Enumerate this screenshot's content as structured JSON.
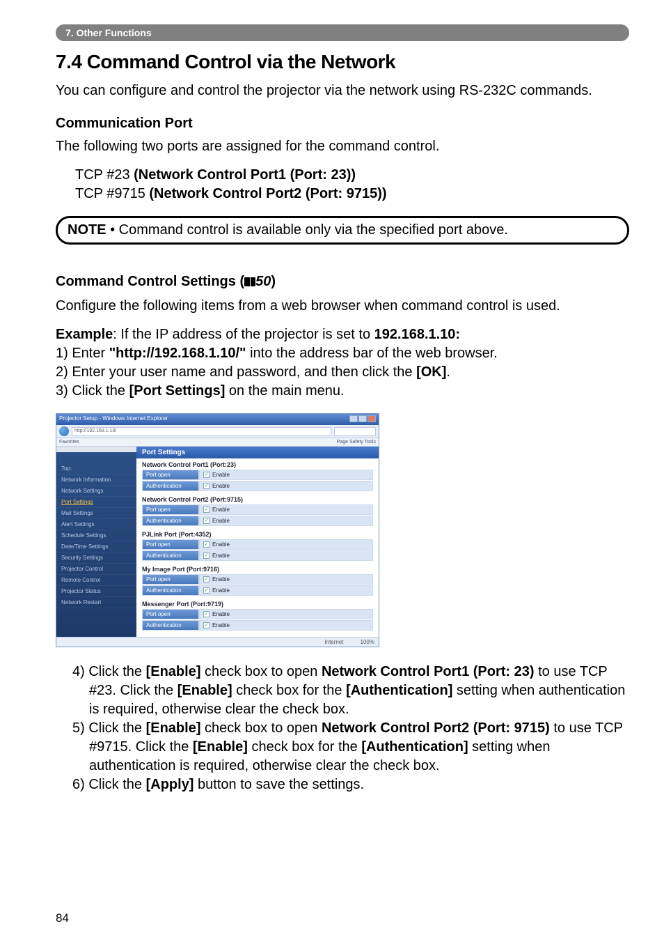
{
  "chapter": "7. Other Functions",
  "section_title": "7.4 Command Control via the Network",
  "intro": "You can configure and control the projector via the network using RS-232C commands.",
  "comm_port_heading": "Communication Port",
  "comm_port_text": "The following two ports are assigned for the command control.",
  "port1_prefix": "TCP #23 ",
  "port1_bold": "(Network Control Port1 (Port: 23))",
  "port2_prefix": "TCP #9715 ",
  "port2_bold": "(Network Control Port2 (Port: 9715))",
  "note_label": "NOTE",
  "note_text": " • Command control is available only via the specified port above.",
  "settings_heading_pre": "Command Control Settings (",
  "settings_heading_ref": "50",
  "settings_heading_post": ")",
  "settings_intro": "Configure the following items from a web browser when command control is used.",
  "example_label": "Example",
  "example_text": ": If the IP address of the projector is set to ",
  "example_ip": "192.168.1.10:",
  "step1_a": "1) Enter ",
  "step1_b": "\"http://192.168.1.10/\"",
  "step1_c": " into the address bar of the web browser.",
  "step2_a": "2) Enter your user name and password, and then click the ",
  "step2_b": "[OK]",
  "step2_c": ".",
  "step3_a": "3) Click the ",
  "step3_b": "[Port Settings]",
  "step3_c": " on the main menu.",
  "screenshot": {
    "window_title": "Projector Setup - Windows Internet Explorer",
    "url": "http://192.168.1.10/",
    "fav_label": "Favorites",
    "toolbar_right": "Page  Safety  Tools ",
    "sidebar": [
      {
        "label": "Top:",
        "active": false
      },
      {
        "label": "Network Information",
        "active": false
      },
      {
        "label": "Network Settings",
        "active": false
      },
      {
        "label": "Port Settings",
        "active": true
      },
      {
        "label": "Mail Settings",
        "active": false
      },
      {
        "label": "Alert Settings",
        "active": false
      },
      {
        "label": "Schedule Settings",
        "active": false
      },
      {
        "label": "Date/Time Settings",
        "active": false
      },
      {
        "label": "Security Settings",
        "active": false
      },
      {
        "label": "Projector Control",
        "active": false
      },
      {
        "label": "Remote Control",
        "active": false
      },
      {
        "label": "Projector Status",
        "active": false
      },
      {
        "label": "Network Restart",
        "active": false
      }
    ],
    "pane_title": "Port Settings",
    "groups": [
      {
        "title": "Network Control Port1 (Port:23)",
        "rows": [
          {
            "lbl": "Port open",
            "val": "Enable"
          },
          {
            "lbl": "Authentication",
            "val": "Enable"
          }
        ]
      },
      {
        "title": "Network Control Port2 (Port:9715)",
        "rows": [
          {
            "lbl": "Port open",
            "val": "Enable"
          },
          {
            "lbl": "Authentication",
            "val": "Enable"
          }
        ]
      },
      {
        "title": "PJLink Port (Port:4352)",
        "rows": [
          {
            "lbl": "Port open",
            "val": "Enable"
          },
          {
            "lbl": "Authentication",
            "val": "Enable"
          }
        ]
      },
      {
        "title": "My Image Port (Port:9716)",
        "rows": [
          {
            "lbl": "Port open",
            "val": "Enable"
          },
          {
            "lbl": "Authentication",
            "val": "Enable"
          }
        ]
      },
      {
        "title": "Messenger Port (Port:9719)",
        "rows": [
          {
            "lbl": "Port open",
            "val": "Enable"
          },
          {
            "lbl": "Authentication",
            "val": "Enable"
          }
        ]
      }
    ],
    "status_left": "Internet",
    "status_right": "100%"
  },
  "step4_a": "4) Click the ",
  "step4_b": "[Enable]",
  "step4_c": " check box to open ",
  "step4_d": "Network Control Port1 (Port: 23)",
  "step4_e": " to use TCP #23. Click the ",
  "step4_f": "[Enable]",
  "step4_g": " check box for the ",
  "step4_h": "[Authentication]",
  "step4_i": " setting when authentication is required, otherwise clear the check box.",
  "step5_a": "5) Click the ",
  "step5_b": "[Enable]",
  "step5_c": " check box to open ",
  "step5_d": "Network Control Port2 (Port: 9715)",
  "step5_e": " to use TCP #9715. Click the ",
  "step5_f": "[Enable]",
  "step5_g": " check box for the ",
  "step5_h": "[Authentication]",
  "step5_i": " setting when authentication is required, otherwise clear the check box.",
  "step6_a": "6) Click the ",
  "step6_b": "[Apply]",
  "step6_c": " button to save the settings.",
  "page_number": "84"
}
